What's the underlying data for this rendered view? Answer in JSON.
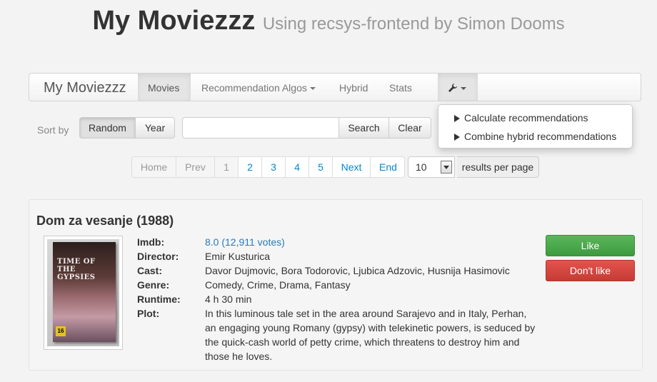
{
  "header": {
    "title": "My Moviezzz",
    "subtitle": "Using recsys-frontend by Simon Dooms"
  },
  "navbar": {
    "brand": "My Moviezzz",
    "items": [
      {
        "label": "Movies",
        "active": true
      },
      {
        "label": "Recommendation Algos",
        "dropdown": true
      },
      {
        "label": "Hybrid"
      },
      {
        "label": "Stats"
      }
    ],
    "tools_icon": "wrench-icon",
    "tools_menu": [
      "Calculate recommendations",
      "Combine hybrid recommendations"
    ]
  },
  "sort": {
    "label": "Sort by",
    "options": [
      "Random",
      "Year"
    ],
    "selected": "Random"
  },
  "search": {
    "value": "",
    "search_label": "Search",
    "clear_label": "Clear"
  },
  "pagination": {
    "items": [
      "Home",
      "Prev",
      "1",
      "2",
      "3",
      "4",
      "5",
      "Next",
      "End"
    ],
    "per_page_value": "10",
    "per_page_label": "results per page"
  },
  "movie": {
    "title": "Dom za vesanje (1988)",
    "poster_text": "TIME OF THE GYPSIES",
    "poster_rating": "16",
    "imdb_label": "Imdb:",
    "imdb": "8.0 (12,911 votes)",
    "director_label": "Director:",
    "director": "Emir Kusturica",
    "cast_label": "Cast:",
    "cast": "Davor Dujmovic, Bora Todorovic, Ljubica Adzovic, Husnija Hasimovic",
    "genre_label": "Genre:",
    "genre": "Comedy, Crime, Drama, Fantasy",
    "runtime_label": "Runtime:",
    "runtime": "4 h 30 min",
    "plot_label": "Plot:",
    "plot": "In this luminous tale set in the area around Sarajevo and in Italy, Perhan, an engaging young Romany (gypsy) with telekinetic powers, is seduced by the quick-cash world of petty crime, which threatens to destroy him and those he loves.",
    "like_label": "Like",
    "dislike_label": "Don't like"
  },
  "colors": {
    "like": "#4cae4c",
    "dislike": "#d9534f",
    "link": "#2a7ab7"
  }
}
